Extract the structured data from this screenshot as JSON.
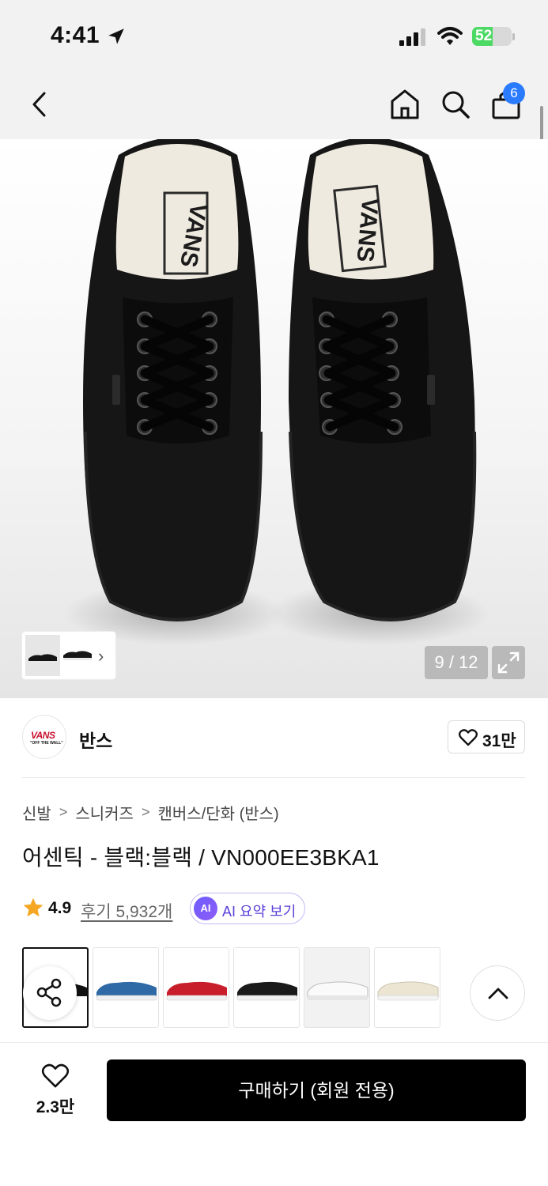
{
  "status_bar": {
    "time": "4:41",
    "battery": "52"
  },
  "header": {
    "cart_count": "6"
  },
  "gallery": {
    "counter": "9 / 12"
  },
  "brand": {
    "name": "반스",
    "logo_text": "VANS",
    "logo_sub": "\"OFF THE WALL\"",
    "likes": "31만"
  },
  "breadcrumb": [
    "신발",
    "스니커즈",
    "캔버스/단화 (반스)"
  ],
  "product": {
    "title": "어센틱 - 블랙:블랙 / VN000EE3BKA1",
    "rating": "4.9",
    "reviews": "후기 5,932개",
    "ai_badge": "AI",
    "ai_summary": "AI 요약 보기"
  },
  "swatches": [
    {
      "name": "black-black",
      "upper": "#141414",
      "sole": "#141414"
    },
    {
      "name": "navy",
      "upper": "#2f6aa6",
      "sole": "#f4f4f4"
    },
    {
      "name": "red",
      "upper": "#c81e2b",
      "sole": "#f4f4f4"
    },
    {
      "name": "black-white",
      "upper": "#1a1a1a",
      "sole": "#f4f4f4"
    },
    {
      "name": "white",
      "upper": "#f7f7f7",
      "sole": "#ededed"
    },
    {
      "name": "cream",
      "upper": "#ece7d6",
      "sole": "#f6f6f6"
    }
  ],
  "bottom_bar": {
    "wish_count": "2.3만",
    "buy_label": "구매하기 (회원 전용)"
  }
}
